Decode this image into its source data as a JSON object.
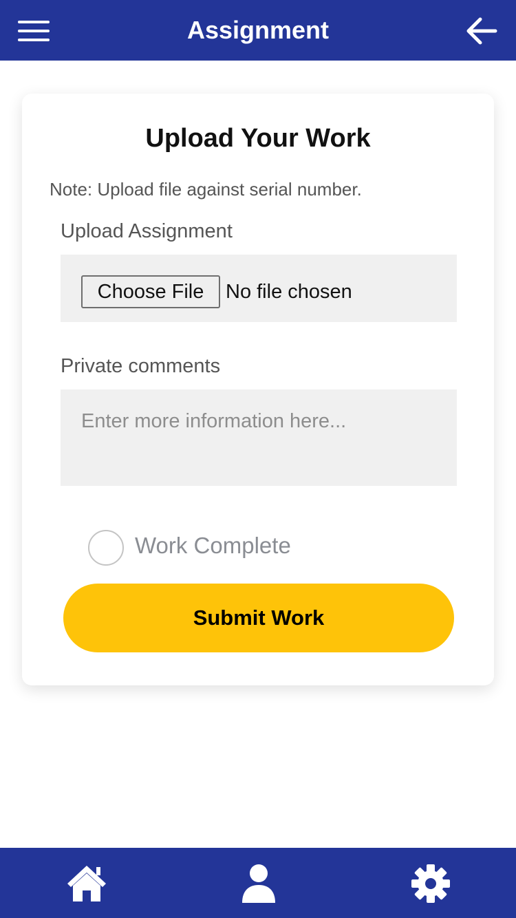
{
  "header": {
    "title": "Assignment",
    "menu_icon": "hamburger-menu-icon",
    "back_icon": "arrow-left-icon",
    "background_color": "#233598"
  },
  "card": {
    "title": "Upload Your Work",
    "note": "Note: Upload file against serial number.",
    "upload": {
      "label": "Upload Assignment",
      "button_label": "Choose File",
      "status": "No file chosen"
    },
    "comments": {
      "label": "Private comments",
      "placeholder": "Enter more information here...",
      "value": ""
    },
    "work_complete": {
      "label": "Work Complete",
      "checked": false
    },
    "submit_label": "Submit Work",
    "submit_color": "#fec309"
  },
  "bottom_nav": {
    "items": [
      {
        "icon": "home-icon"
      },
      {
        "icon": "user-icon"
      },
      {
        "icon": "gear-icon"
      }
    ],
    "background_color": "#233598"
  }
}
